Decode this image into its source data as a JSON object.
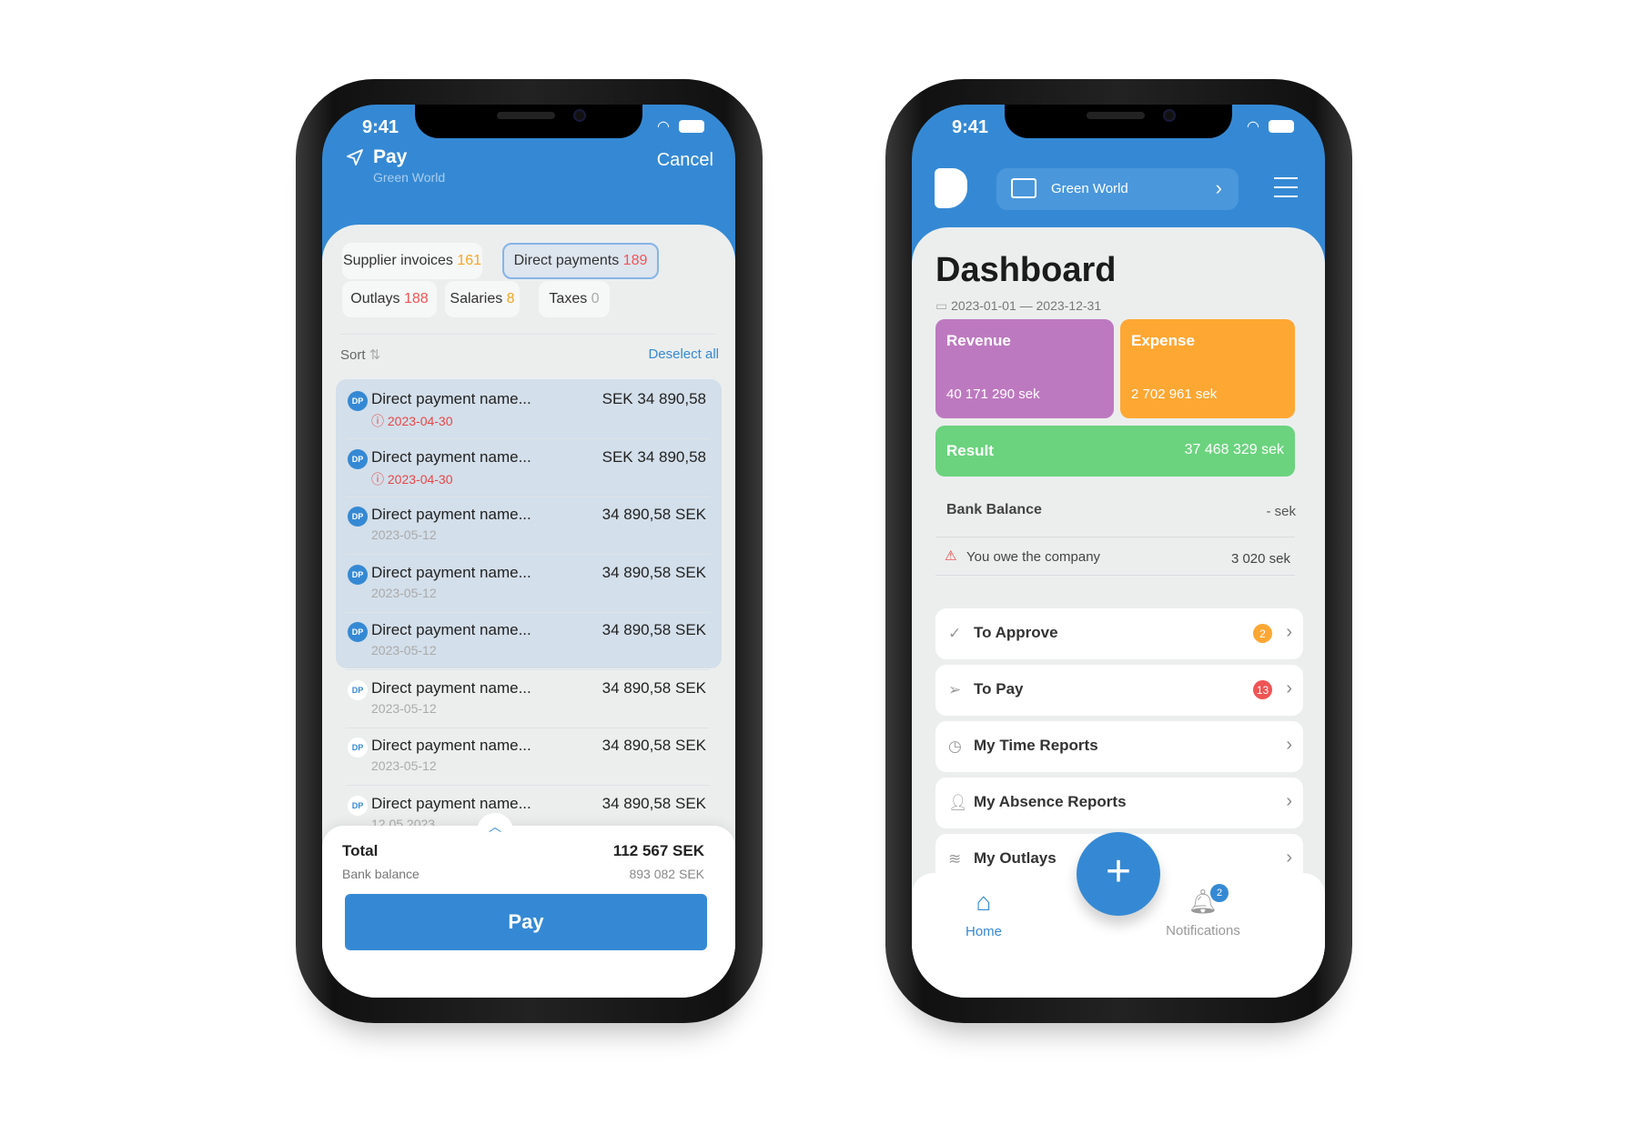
{
  "status_bar": {
    "time": "9:41"
  },
  "pay_screen": {
    "title": "Pay",
    "subtitle": "Green World",
    "cancel": "Cancel",
    "tabs": [
      {
        "label": "Supplier invoices",
        "count": "161",
        "count_color": "#f5a623",
        "selected": false
      },
      {
        "label": "Direct payments",
        "count": "189",
        "count_color": "#f05454",
        "selected": true
      },
      {
        "label": "Outlays",
        "count": "188",
        "count_color": "#f05454",
        "selected": false
      },
      {
        "label": "Salaries",
        "count": "8",
        "count_color": "#f5a623",
        "selected": false
      },
      {
        "label": "Taxes",
        "count": "0",
        "count_color": "#aaaaaa",
        "selected": false
      }
    ],
    "sort_label": "Sort",
    "deselect_all": "Deselect all",
    "items": [
      {
        "badge": "DP",
        "name": "Direct payment name...",
        "amount": "SEK 34 890,58",
        "date": "2023-04-30",
        "overdue": true,
        "selected": true
      },
      {
        "badge": "DP",
        "name": "Direct payment name...",
        "amount": "SEK 34 890,58",
        "date": "2023-04-30",
        "overdue": true,
        "selected": true
      },
      {
        "badge": "DP",
        "name": "Direct payment name...",
        "amount": "34 890,58 SEK",
        "date": "2023-05-12",
        "overdue": false,
        "selected": true
      },
      {
        "badge": "DP",
        "name": "Direct payment name...",
        "amount": "34 890,58 SEK",
        "date": "2023-05-12",
        "overdue": false,
        "selected": true
      },
      {
        "badge": "DP",
        "name": "Direct payment name...",
        "amount": "34 890,58 SEK",
        "date": "2023-05-12",
        "overdue": false,
        "selected": true
      },
      {
        "badge": "DP",
        "name": "Direct payment name...",
        "amount": "34 890,58 SEK",
        "date": "2023-05-12",
        "overdue": false,
        "selected": false
      },
      {
        "badge": "DP",
        "name": "Direct payment name...",
        "amount": "34 890,58 SEK",
        "date": "2023-05-12",
        "overdue": false,
        "selected": false
      },
      {
        "badge": "DP",
        "name": "Direct payment name...",
        "amount": "34 890,58 SEK",
        "date": "12.05.2023",
        "overdue": false,
        "selected": false
      }
    ],
    "total_label": "Total",
    "total_value": "112 567 SEK",
    "bank_balance_label": "Bank balance",
    "bank_balance_value": "893 082 SEK",
    "pay_button": "Pay"
  },
  "dashboard": {
    "company": "Green World",
    "title": "Dashboard",
    "date_range": "2023-01-01 — 2023-12-31",
    "revenue": {
      "label": "Revenue",
      "value": "40 171 290 sek",
      "color": "#bd79bf"
    },
    "expense": {
      "label": "Expense",
      "value": "2 702 961 sek",
      "color": "#ffa733"
    },
    "result": {
      "label": "Result",
      "value": "37 468 329 sek",
      "color": "#6bd37e"
    },
    "bank_balance": {
      "label": "Bank Balance",
      "value": "- sek"
    },
    "owe": {
      "label": "You owe the company",
      "value": "3 020 sek"
    },
    "menu": [
      {
        "icon": "check-icon",
        "label": "To Approve",
        "badge": "2",
        "badge_color": "#ffa733"
      },
      {
        "icon": "send-icon",
        "label": "To Pay",
        "badge": "13",
        "badge_color": "#f05454"
      },
      {
        "icon": "clock-icon",
        "label": "My Time Reports"
      },
      {
        "icon": "user-icon",
        "label": "My Absence Reports"
      },
      {
        "icon": "layers-icon",
        "label": "My Outlays"
      }
    ],
    "nav": {
      "home": "Home",
      "notifications": "Notifications",
      "notifications_badge": "2"
    },
    "accent": "#3589d4"
  }
}
